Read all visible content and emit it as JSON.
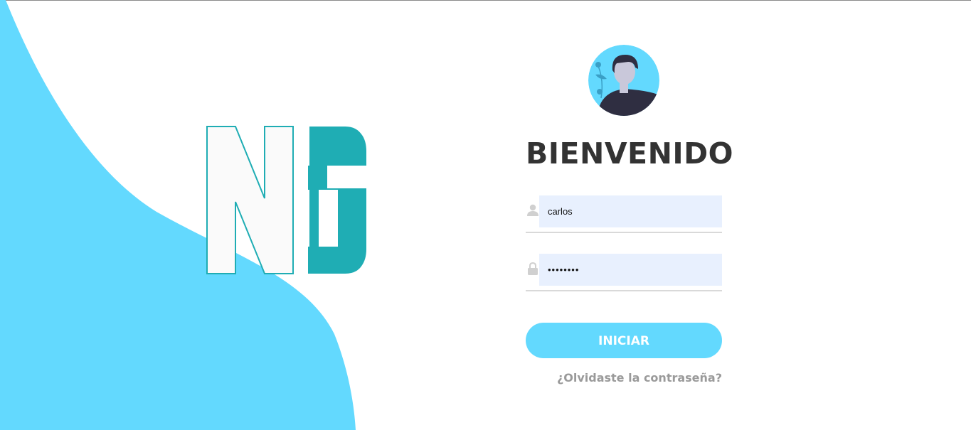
{
  "colors": {
    "accent": "#63d9fe",
    "logo_teal": "#1fadb4",
    "title": "#333333",
    "input_bg": "#e8f0fe",
    "link": "#9a9a9a"
  },
  "branding": {
    "logo_text": "NG"
  },
  "login": {
    "title": "BIENVENIDO",
    "username": {
      "icon": "user-icon",
      "value": "carlos"
    },
    "password": {
      "icon": "lock-icon",
      "value": "carlos12"
    },
    "submit_label": "INICIAR",
    "forgot_label": "¿Olvidaste la contraseña?"
  }
}
